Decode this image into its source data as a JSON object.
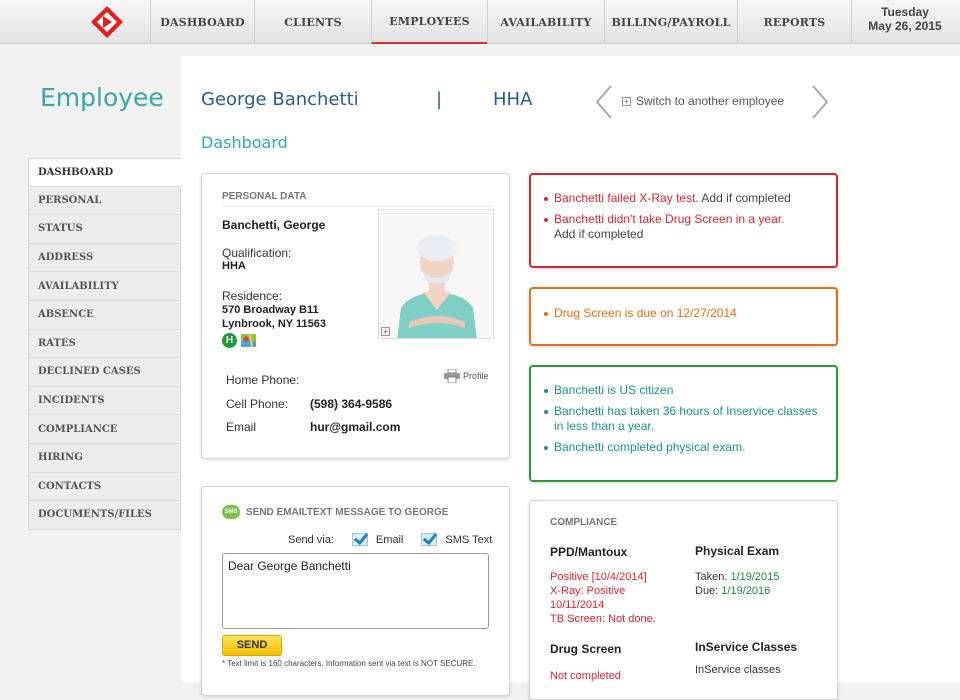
{
  "nav": {
    "items": [
      "DASHBOARD",
      "CLIENTS",
      "EMPLOYEES",
      "AVAILABILITY",
      "BILLING/PAYROLL",
      "REPORTS"
    ],
    "active": "EMPLOYEES",
    "date_day": "Tuesday",
    "date": "May 26, 2015"
  },
  "page": {
    "section": "Employee",
    "employee_name": "George Banchetti",
    "separator": "|",
    "role": "HHA",
    "switch_label": "Switch to another employee",
    "subtitle": "Dashboard"
  },
  "sidebar": {
    "items": [
      "DASHBOARD",
      "PERSONAL",
      "STATUS",
      "ADDRESS",
      "AVAILABILITY",
      "ABSENCE",
      "RATES",
      "DECLINED CASES",
      "INCIDENTS",
      "COMPLIANCE",
      "HIRING",
      "CONTACTS",
      "DOCUMENTS/FILES"
    ],
    "active": "DASHBOARD"
  },
  "personal": {
    "header": "PERSONAL DATA",
    "name": "Banchetti, George",
    "qualification_label": "Qualification:",
    "qualification": "HHA",
    "residence_label": "Residence:",
    "address1": "570 Broadway B11",
    "address2": "Lynbrook, NY 11563",
    "badge": "H",
    "home_phone_label": "Home Phone:",
    "home_phone": "",
    "cell_phone_label": "Cell Phone:",
    "cell_phone": "(598) 364-9586",
    "email_label": "Email",
    "email": "hur@gmail.com",
    "profile_label": "Profile"
  },
  "alerts": {
    "red": [
      "Banchetti failed X-Ray test.",
      "Add if completed",
      "Banchetti didn't take Drug Screen in a year.",
      "Add if completed"
    ],
    "orange": [
      "Drug Screen is due on 12/27/2014"
    ],
    "green": [
      "Banchetti is US citizen",
      "Banchetti has taken 36 hours of Inservice classes in less than a year.",
      "Banchetti completed physical exam."
    ]
  },
  "message": {
    "header": "SEND EMAILTEXT MESSAGE TO GEORGE",
    "icon_text": "SMS",
    "send_via_label": "Send via:",
    "email_option": "Email",
    "sms_option": "SMS Text",
    "body": "Dear George Banchetti",
    "send_label": "SEND",
    "note": "* Text limit is 160 characters. Information sent via text is NOT SECURE."
  },
  "compliance": {
    "header": "COMPLIANCE",
    "ppd_title": "PPD/Mantoux",
    "ppd_line1": "Positive [10/4/2014]",
    "ppd_line2": "X-Ray: Positive",
    "ppd_line3": "10/11/2014",
    "ppd_line4": "TB  Screen: Not done.",
    "physical_title": "Physical Exam",
    "taken_label": "Taken: ",
    "taken_date": "1/19/2015",
    "due_label": "Due: ",
    "due_date": "1/19/2016",
    "drug_title": "Drug Screen",
    "drug_status": "Not completed",
    "inservice_title": "InService Classes",
    "inservice_text": "InService classes"
  },
  "colors": {
    "accent_teal": "#3aa6a6",
    "name_blue": "#2a5d8c",
    "alert_red": "#d7262f",
    "alert_orange": "#e56d17",
    "alert_green": "#21908a"
  }
}
